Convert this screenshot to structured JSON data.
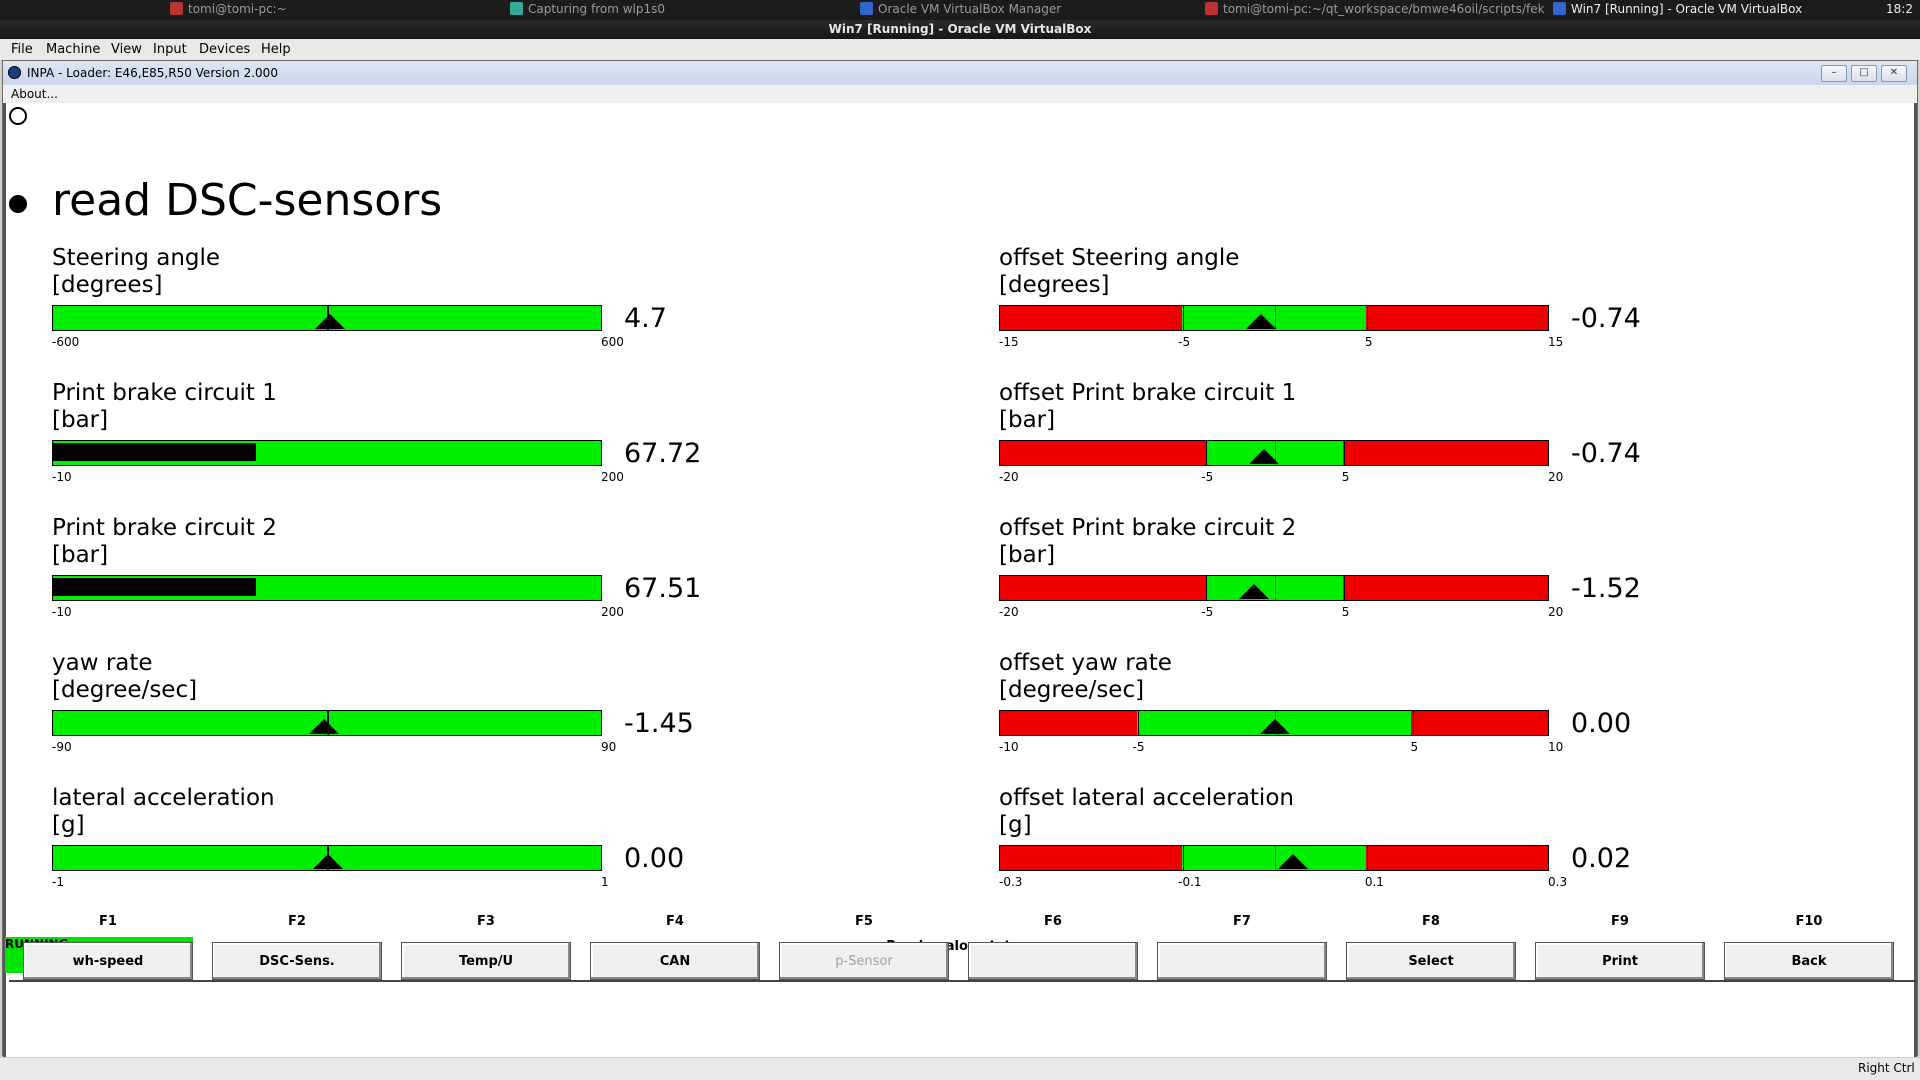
{
  "taskbar": {
    "items": [
      {
        "label": "tomi@tomi-pc:~"
      },
      {
        "label": "Capturing from wlp1s0"
      },
      {
        "label": "Oracle VM VirtualBox Manager"
      },
      {
        "label": "tomi@tomi-pc:~/qt_workspace/bmwe46oil/scripts/fek"
      },
      {
        "label": "Win7 [Running] - Oracle VM VirtualBox"
      }
    ],
    "clock": "18:2"
  },
  "vbox": {
    "title": "Win7 [Running] - Oracle VM VirtualBox",
    "menu": [
      "File",
      "Machine",
      "View",
      "Input",
      "Devices",
      "Help"
    ],
    "host_key": "Right Ctrl"
  },
  "inpa": {
    "title": "INPA - Loader:  E46,E85,R50 Version 2.000",
    "menu_about": "About...",
    "page_title": "read DSC-sensors"
  },
  "colors": {
    "ok": "#00ee00",
    "bad": "#ee0000",
    "running": "#00e400"
  },
  "gauges_left": [
    {
      "name": "Steering angle",
      "unit": "[degrees]",
      "min": "-600",
      "max": "600",
      "value": "4.7",
      "marker": 0.504
    },
    {
      "name": "Print brake circuit 1",
      "unit": "[bar]",
      "min": "-10",
      "max": "200",
      "value": "67.72",
      "fill": 0.37
    },
    {
      "name": "Print brake circuit 2",
      "unit": "[bar]",
      "min": "-10",
      "max": "200",
      "value": "67.51",
      "fill": 0.37
    },
    {
      "name": "yaw rate",
      "unit": "[degree/sec]",
      "min": "-90",
      "max": "90",
      "value": "-1.45",
      "marker": 0.492
    },
    {
      "name": "lateral acceleration",
      "unit": "[g]",
      "min": "-1",
      "max": "1",
      "value": "0.00",
      "marker": 0.5
    }
  ],
  "gauges_right": [
    {
      "name": "offset Steering angle",
      "unit": "[degrees]",
      "min": "-15",
      "lo": "-5",
      "hi": "5",
      "max": "15",
      "value": "-0.74",
      "lo_frac": 0.333,
      "hi_frac": 0.667,
      "marker": 0.475
    },
    {
      "name": "offset Print brake circuit 1",
      "unit": "[bar]",
      "min": "-20",
      "lo": "-5",
      "hi": "5",
      "max": "20",
      "value": "-0.74",
      "lo_frac": 0.375,
      "hi_frac": 0.625,
      "marker": 0.48
    },
    {
      "name": "offset Print brake circuit 2",
      "unit": "[bar]",
      "min": "-20",
      "lo": "-5",
      "hi": "5",
      "max": "20",
      "value": "-1.52",
      "lo_frac": 0.375,
      "hi_frac": 0.625,
      "marker": 0.462
    },
    {
      "name": "offset yaw rate",
      "unit": "[degree/sec]",
      "min": "-10",
      "lo": "-5",
      "hi": "5",
      "max": "10",
      "value": "0.00",
      "lo_frac": 0.25,
      "hi_frac": 0.75,
      "marker": 0.5
    },
    {
      "name": "offset lateral acceleration",
      "unit": "[g]",
      "min": "-0.3",
      "lo": "-0.1",
      "hi": "0.1",
      "max": "0.3",
      "value": "0.02",
      "lo_frac": 0.333,
      "hi_frac": 0.667,
      "marker": 0.533
    }
  ],
  "status": {
    "state": "RUNNING",
    "message": "Read analog status"
  },
  "fkeys": [
    {
      "key": "F1",
      "label": "wh-speed",
      "enabled": true
    },
    {
      "key": "F2",
      "label": "DSC-Sens.",
      "enabled": true
    },
    {
      "key": "F3",
      "label": "Temp/U",
      "enabled": true
    },
    {
      "key": "F4",
      "label": "CAN",
      "enabled": true
    },
    {
      "key": "F5",
      "label": "p-Sensor",
      "enabled": false
    },
    {
      "key": "F6",
      "label": "",
      "enabled": true
    },
    {
      "key": "F7",
      "label": "",
      "enabled": true
    },
    {
      "key": "F8",
      "label": "Select",
      "enabled": true
    },
    {
      "key": "F9",
      "label": "Print",
      "enabled": true
    },
    {
      "key": "F10",
      "label": "Back",
      "enabled": true
    }
  ]
}
